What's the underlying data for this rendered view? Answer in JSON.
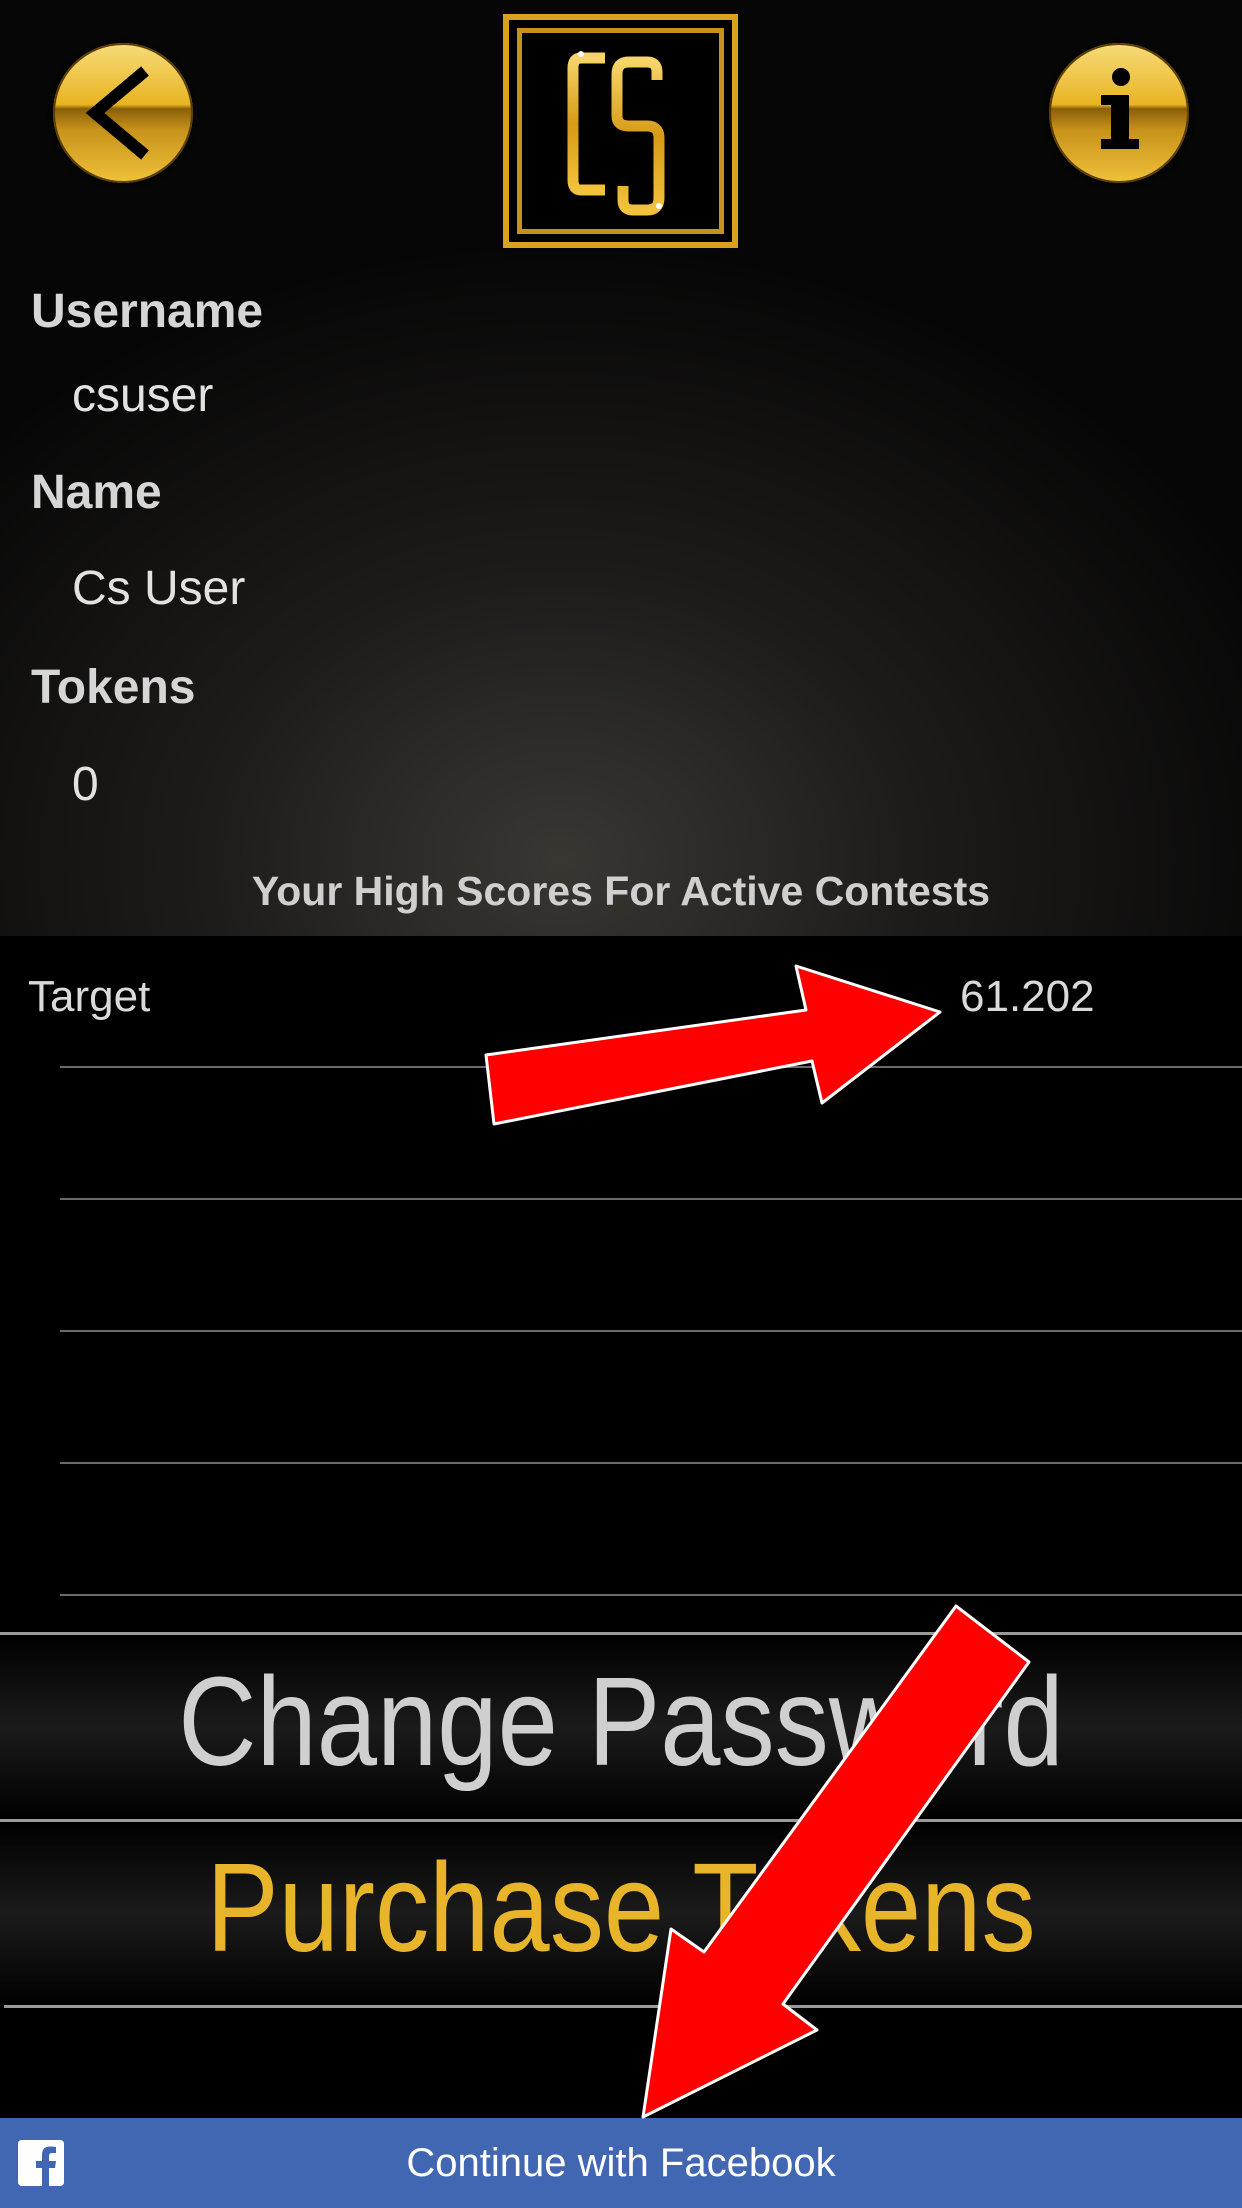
{
  "header": {
    "back_icon": "chevron-left-icon",
    "logo_text": "Cs",
    "info_icon": "info-icon"
  },
  "profile": {
    "username_label": "Username",
    "username_value": "csuser",
    "name_label": "Name",
    "name_value": "Cs User",
    "tokens_label": "Tokens",
    "tokens_value": "0"
  },
  "scores": {
    "heading": "Your High Scores For Active Contests",
    "rows": [
      {
        "name": "Target",
        "score": "61.202"
      }
    ]
  },
  "actions": {
    "change_password_label": "Change Password",
    "purchase_tokens_label": "Purchase Tokens"
  },
  "facebook": {
    "label": "Continue with Facebook",
    "icon": "facebook-icon"
  },
  "colors": {
    "gold": "#e8b52a",
    "facebook_blue": "#4267b2",
    "annotation_red": "#ff0000"
  }
}
